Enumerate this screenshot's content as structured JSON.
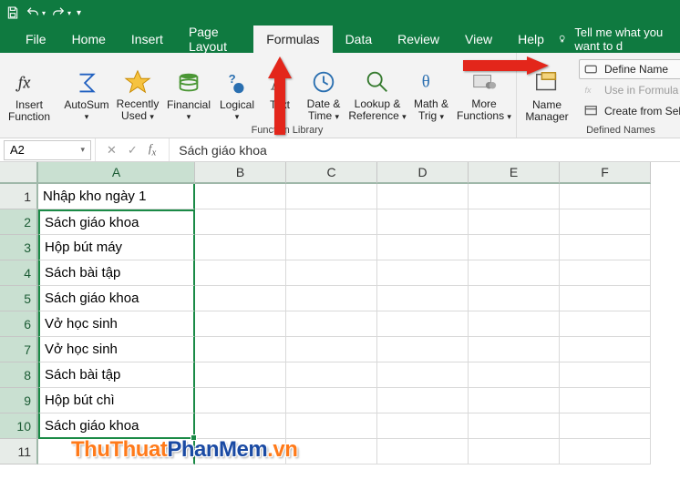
{
  "qat": {
    "save": "save",
    "undo": "undo",
    "redo": "redo"
  },
  "menu": {
    "items": [
      "File",
      "Home",
      "Insert",
      "Page Layout",
      "Formulas",
      "Data",
      "Review",
      "View",
      "Help"
    ],
    "active": "Formulas",
    "tellme": "Tell me what you want to d"
  },
  "ribbon": {
    "insert_function_l1": "Insert",
    "insert_function_l2": "Function",
    "autosum": "AutoSum",
    "recently_l1": "Recently",
    "recently_l2": "Used",
    "financial": "Financial",
    "logical": "Logical",
    "text": "Text",
    "datetime_l1": "Date &",
    "datetime_l2": "Time",
    "lookup_l1": "Lookup &",
    "lookup_l2": "Reference",
    "math_l1": "Math &",
    "math_l2": "Trig",
    "more_l1": "More",
    "more_l2": "Functions",
    "group_fl": "Function Library",
    "name_mgr_l1": "Name",
    "name_mgr_l2": "Manager",
    "define_name": "Define Name",
    "use_in_formula": "Use in Formula",
    "create_from_sel": "Create from Selection",
    "group_dn": "Defined Names"
  },
  "formula_bar": {
    "name_box": "A2",
    "formula": "Sách giáo khoa"
  },
  "columns": [
    "A",
    "B",
    "C",
    "D",
    "E",
    "F"
  ],
  "rows": [
    {
      "n": "1",
      "A": "Nhập kho ngày 1"
    },
    {
      "n": "2",
      "A": "Sách giáo khoa"
    },
    {
      "n": "3",
      "A": "Hộp bút máy"
    },
    {
      "n": "4",
      "A": "Sách bài tập"
    },
    {
      "n": "5",
      "A": "Sách giáo khoa"
    },
    {
      "n": "6",
      "A": "Vở học sinh"
    },
    {
      "n": "7",
      "A": "Vở học sinh"
    },
    {
      "n": "8",
      "A": "Sách bài tập"
    },
    {
      "n": "9",
      "A": "Hộp bút chì"
    },
    {
      "n": "10",
      "A": "Sách giáo khoa"
    },
    {
      "n": "11",
      "A": ""
    }
  ],
  "watermark": {
    "a": "ThuThuat",
    "b": "PhanMem",
    "c": ".vn"
  },
  "chart_data": {
    "type": "table",
    "title": "",
    "columns": [
      "A"
    ],
    "rows": [
      [
        "Nhập kho ngày 1"
      ],
      [
        "Sách giáo khoa"
      ],
      [
        "Hộp bút máy"
      ],
      [
        "Sách bài tập"
      ],
      [
        "Sách giáo khoa"
      ],
      [
        "Vở học sinh"
      ],
      [
        "Vở học sinh"
      ],
      [
        "Sách bài tập"
      ],
      [
        "Hộp bút chì"
      ],
      [
        "Sách giáo khoa"
      ]
    ],
    "selected_range": "A2:A10",
    "active_cell": "A2"
  }
}
